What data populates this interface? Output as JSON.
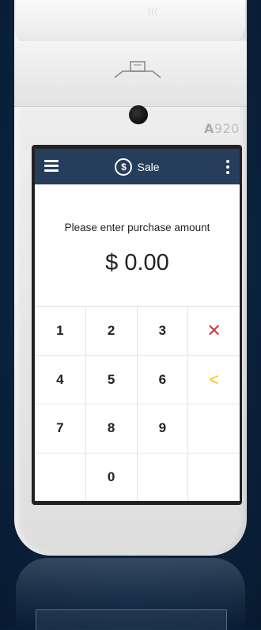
{
  "device": {
    "brand_letter": "A",
    "brand_model": "920",
    "nfc_label": "((( "
  },
  "app_bar": {
    "title": "Sale",
    "currency_symbol": "$",
    "menu_icon": "hamburger-icon",
    "more_icon": "kebab-icon"
  },
  "main": {
    "prompt": "Please enter purchase amount",
    "amount": "$ 0.00"
  },
  "keypad": {
    "keys": [
      "1",
      "2",
      "3",
      "✕",
      "4",
      "5",
      "6",
      "<",
      "7",
      "8",
      "9",
      "",
      "",
      "0",
      "",
      ""
    ],
    "cancel_color": "#d23b3b",
    "backspace_color": "#f3c622"
  },
  "colors": {
    "app_bar": "#273d5c",
    "background": "#0b2440"
  }
}
